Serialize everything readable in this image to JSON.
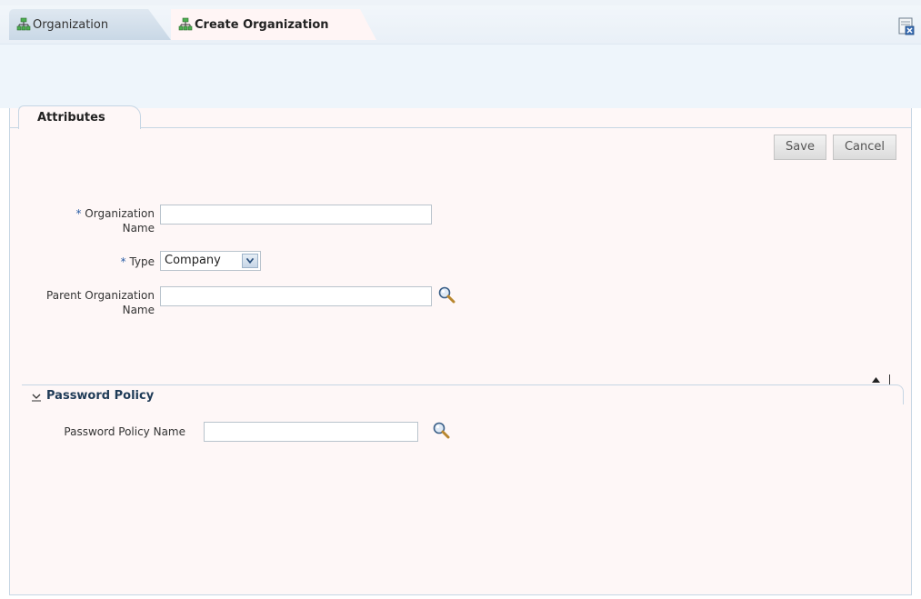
{
  "tabs": [
    {
      "label": "Organization",
      "icon": "organization-icon",
      "active": false
    },
    {
      "label": "Create Organization",
      "icon": "organization-icon",
      "active": true
    }
  ],
  "close_icon": "close-tab-icon",
  "subtab": {
    "label": "Attributes"
  },
  "toolbar": {
    "save_label": "Save",
    "cancel_label": "Cancel"
  },
  "form": {
    "org_name": {
      "required_mark": "*",
      "label_line1": "Organization",
      "label_line2": "Name",
      "value": ""
    },
    "type": {
      "required_mark": "*",
      "label": "Type",
      "selected": "Company"
    },
    "parent_org": {
      "label_line1": "Parent Organization",
      "label_line2": "Name",
      "value": ""
    }
  },
  "password_policy": {
    "title": "Password Policy",
    "field_label": "Password Policy Name",
    "value": ""
  },
  "colors": {
    "accent": "#2a5ea5",
    "panel_bg": "#fef7f7",
    "border": "#c6d6e4"
  }
}
